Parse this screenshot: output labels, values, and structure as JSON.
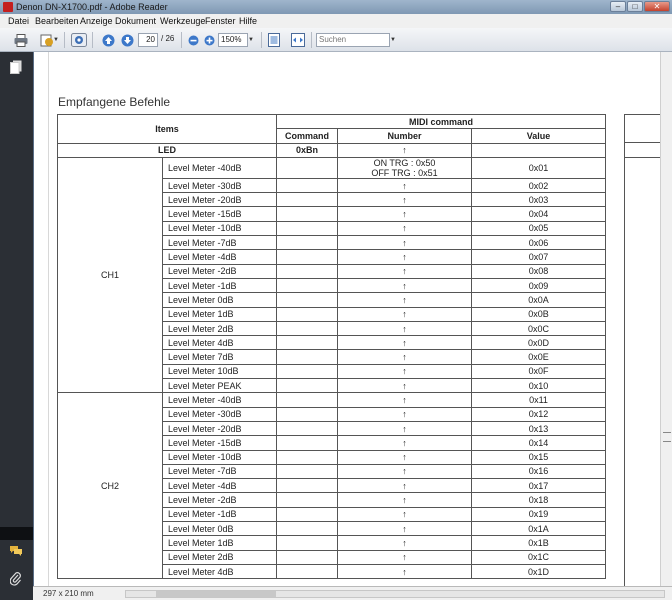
{
  "window": {
    "title": "Denon DN-X1700.pdf - Adobe Reader",
    "controls": [
      "–",
      "□",
      "✕"
    ]
  },
  "menu": [
    "Datei",
    "Bearbeiten",
    "Anzeige",
    "Dokument",
    "Werkzeuge",
    "Fenster",
    "Hilfe"
  ],
  "toolbar": {
    "page_current": "20",
    "page_total": "/ 26",
    "zoom": "150%",
    "search_placeholder": "Suchen"
  },
  "document": {
    "heading": "Empfangene Befehle",
    "headers": {
      "items": "Items",
      "midi": "MIDI command",
      "command": "Command",
      "number": "Number",
      "value": "Value"
    },
    "led_row": {
      "label": "LED",
      "command": "0xBn",
      "number": "↑"
    },
    "groups": [
      {
        "name": "CH1",
        "rows": [
          {
            "item": "Level Meter -40dB",
            "number": [
              "ON TRG : 0x50",
              "OFF TRG : 0x51"
            ],
            "value": "0x01"
          },
          {
            "item": "Level Meter -30dB",
            "number": "↑",
            "value": "0x02"
          },
          {
            "item": "Level Meter -20dB",
            "number": "↑",
            "value": "0x03"
          },
          {
            "item": "Level Meter -15dB",
            "number": "↑",
            "value": "0x04"
          },
          {
            "item": "Level Meter -10dB",
            "number": "↑",
            "value": "0x05"
          },
          {
            "item": "Level Meter -7dB",
            "number": "↑",
            "value": "0x06"
          },
          {
            "item": "Level Meter -4dB",
            "number": "↑",
            "value": "0x07"
          },
          {
            "item": "Level Meter -2dB",
            "number": "↑",
            "value": "0x08"
          },
          {
            "item": "Level Meter -1dB",
            "number": "↑",
            "value": "0x09"
          },
          {
            "item": "Level Meter 0dB",
            "number": "↑",
            "value": "0x0A"
          },
          {
            "item": "Level Meter 1dB",
            "number": "↑",
            "value": "0x0B"
          },
          {
            "item": "Level Meter 2dB",
            "number": "↑",
            "value": "0x0C"
          },
          {
            "item": "Level Meter 4dB",
            "number": "↑",
            "value": "0x0D"
          },
          {
            "item": "Level Meter 7dB",
            "number": "↑",
            "value": "0x0E"
          },
          {
            "item": "Level Meter 10dB",
            "number": "↑",
            "value": "0x0F"
          },
          {
            "item": "Level Meter PEAK",
            "number": "↑",
            "value": "0x10"
          }
        ]
      },
      {
        "name": "CH2",
        "rows": [
          {
            "item": "Level Meter -40dB",
            "number": "↑",
            "value": "0x11"
          },
          {
            "item": "Level Meter -30dB",
            "number": "↑",
            "value": "0x12"
          },
          {
            "item": "Level Meter -20dB",
            "number": "↑",
            "value": "0x13"
          },
          {
            "item": "Level Meter -15dB",
            "number": "↑",
            "value": "0x14"
          },
          {
            "item": "Level Meter -10dB",
            "number": "↑",
            "value": "0x15"
          },
          {
            "item": "Level Meter -7dB",
            "number": "↑",
            "value": "0x16"
          },
          {
            "item": "Level Meter -4dB",
            "number": "↑",
            "value": "0x17"
          },
          {
            "item": "Level Meter -2dB",
            "number": "↑",
            "value": "0x18"
          },
          {
            "item": "Level Meter -1dB",
            "number": "↑",
            "value": "0x19"
          },
          {
            "item": "Level Meter 0dB",
            "number": "↑",
            "value": "0x1A"
          },
          {
            "item": "Level Meter 1dB",
            "number": "↑",
            "value": "0x1B"
          },
          {
            "item": "Level Meter 2dB",
            "number": "↑",
            "value": "0x1C"
          },
          {
            "item": "Level Meter 4dB",
            "number": "↑",
            "value": "0x1D"
          }
        ]
      }
    ]
  },
  "status": {
    "page_size": "297 x 210 mm"
  }
}
